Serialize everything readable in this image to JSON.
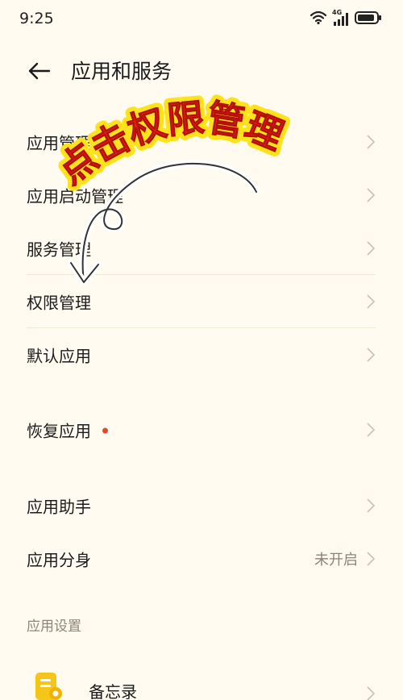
{
  "status_bar": {
    "time": "9:25",
    "network_label": "4G",
    "icons": [
      "wifi-icon",
      "signal-icon",
      "battery-icon"
    ]
  },
  "header": {
    "title": "应用和服务",
    "back_icon": "arrow-left-icon"
  },
  "menu": {
    "items": [
      {
        "label": "应用管理"
      },
      {
        "label": "应用启动管理"
      },
      {
        "label": "服务管理"
      },
      {
        "label": "权限管理"
      },
      {
        "label": "默认应用"
      },
      {
        "label": "恢复应用"
      },
      {
        "label": "应用助手"
      },
      {
        "label": "应用分身",
        "value": "未开启"
      }
    ]
  },
  "section": {
    "label": "应用设置"
  },
  "apps": [
    {
      "label": "备忘录",
      "icon": "memo-app-icon"
    }
  ],
  "annotation": {
    "text": "点击权限管理",
    "color": "#e3201b",
    "outline_color": "#ffe21a"
  },
  "colors": {
    "background": "#fffbf1",
    "text": "#1b1b1b",
    "secondary_text": "#8c8678",
    "dot": "#e8452e"
  }
}
